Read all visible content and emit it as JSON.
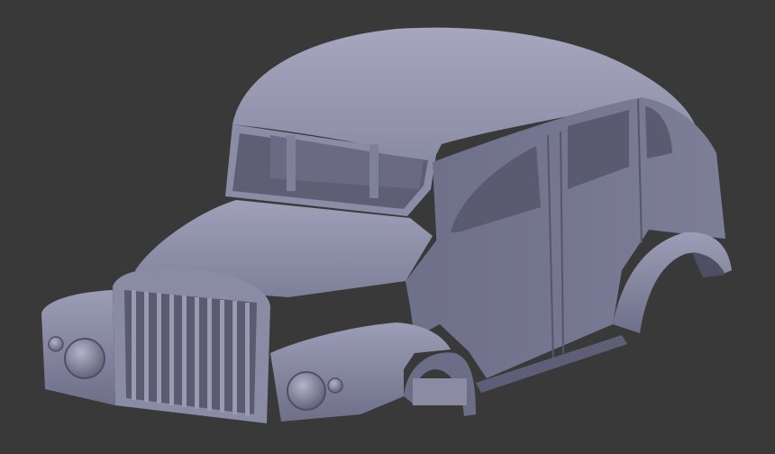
{
  "viewport": {
    "background_color": "#393939",
    "model_base_color": "#7a7b93",
    "model_highlight_color": "#a3a4bc",
    "model_shadow_color": "#4e4f63",
    "interior_color": "#5c5d73"
  },
  "model": {
    "subject": "3d-render-vintage-truck-cab-body"
  }
}
